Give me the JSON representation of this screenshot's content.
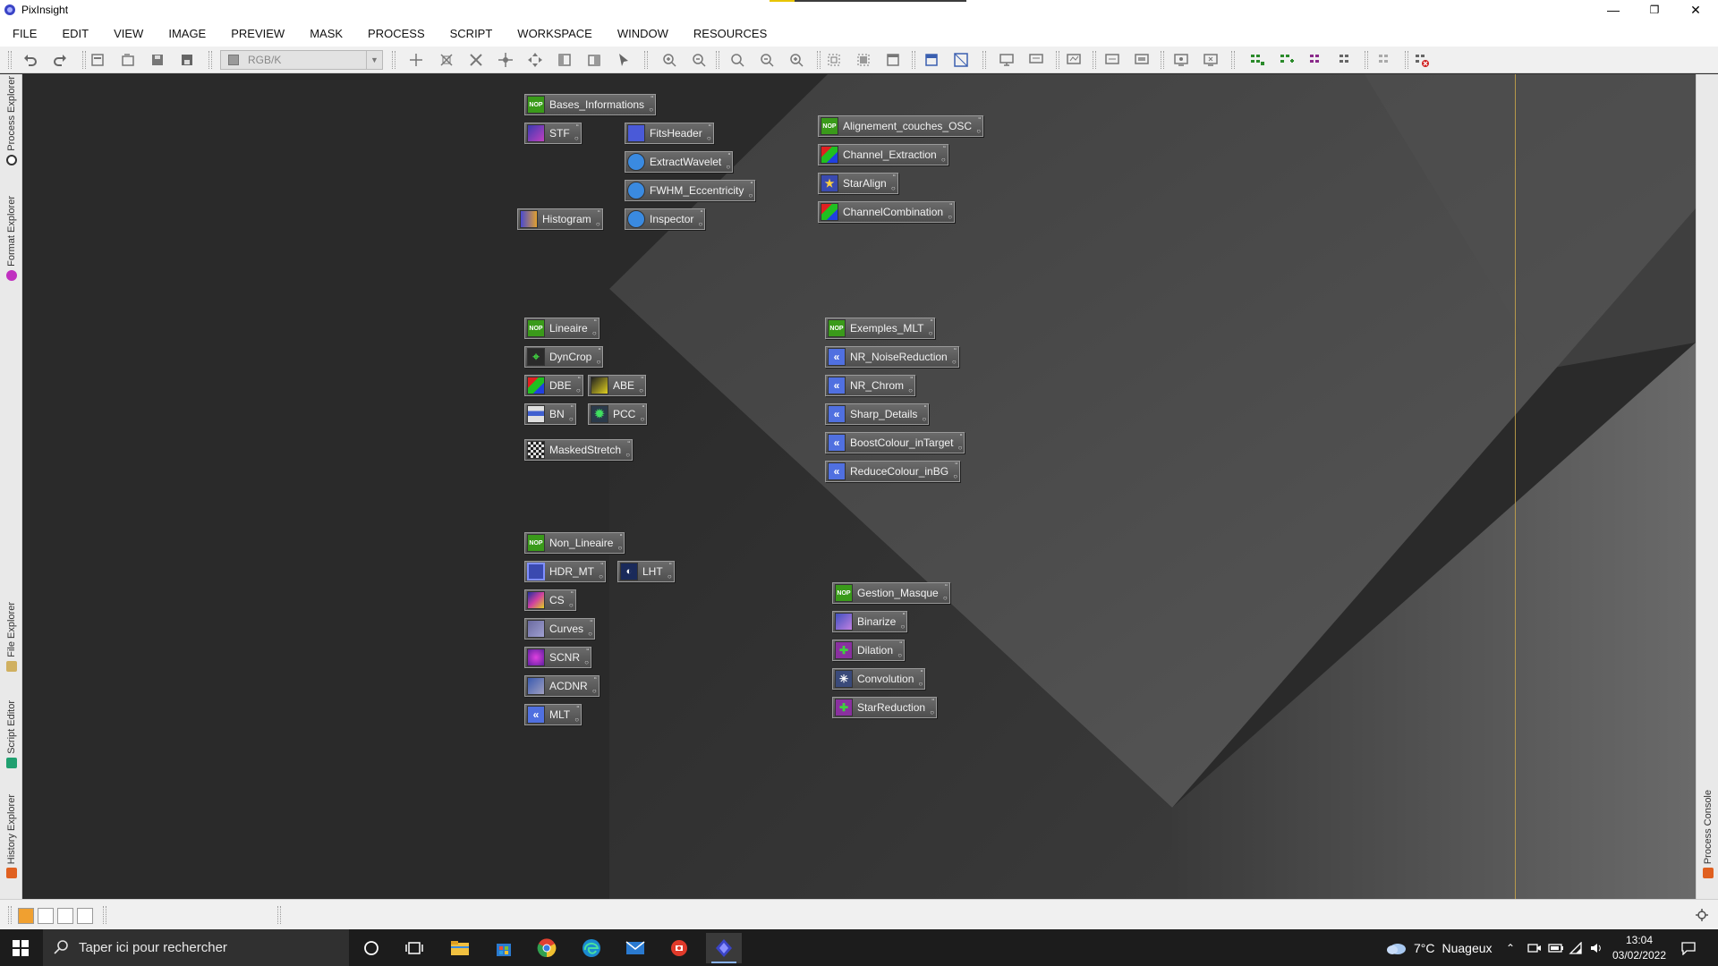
{
  "window": {
    "title": "PixInsight"
  },
  "menu": [
    "FILE",
    "EDIT",
    "VIEW",
    "IMAGE",
    "PREVIEW",
    "MASK",
    "PROCESS",
    "SCRIPT",
    "WORKSPACE",
    "WINDOW",
    "RESOURCES"
  ],
  "toolbar": {
    "colorspace": "RGB/K"
  },
  "left_tabs": {
    "process_explorer": "Process Explorer",
    "format_explorer": "Format Explorer",
    "file_explorer": "File Explorer",
    "script_editor": "Script Editor",
    "history_explorer": "History Explorer"
  },
  "right_tabs": {
    "process_console": "Process Console"
  },
  "process_icons": {
    "bases_informations": "Bases_Informations",
    "stf": "STF",
    "fitsheader": "FitsHeader",
    "extractwavelet": "ExtractWavelet",
    "fwhm_eccentricity": "FWHM_Eccentricity",
    "histogram": "Histogram",
    "inspector": "Inspector",
    "alignement_couches_osc": "Alignement_couches_OSC",
    "channel_extraction": "Channel_Extraction",
    "staralign": "StarAlign",
    "channelcombination": "ChannelCombination",
    "lineaire": "Lineaire",
    "dyncrop": "DynCrop",
    "dbe": "DBE",
    "abe": "ABE",
    "bn": "BN",
    "pcc": "PCC",
    "maskedstretch": "MaskedStretch",
    "exemples_mlt": "Exemples_MLT",
    "nr_noisereduction": "NR_NoiseReduction",
    "nr_chrom": "NR_Chrom",
    "sharp_details": "Sharp_Details",
    "boostcolour_intarget": "BoostColour_inTarget",
    "reducecolour_inbg": "ReduceColour_inBG",
    "non_lineaire": "Non_Lineaire",
    "hdr_mt": "HDR_MT",
    "lht": "LHT",
    "cs": "CS",
    "curves": "Curves",
    "scnr": "SCNR",
    "acdnr": "ACDNR",
    "mlt": "MLT",
    "gestion_masque": "Gestion_Masque",
    "binarize": "Binarize",
    "dilation": "Dilation",
    "convolution": "Convolution",
    "starreduction": "StarReduction"
  },
  "nop_badge": "NOP",
  "taskbar": {
    "search_placeholder": "Taper ici pour rechercher",
    "weather_temp": "7°C",
    "weather_desc": "Nuageux",
    "time": "13:04",
    "date": "03/02/2022"
  },
  "colors": {
    "nop_green": "#3a9a1a",
    "workspace_bg": "#2a2a2a",
    "accent_line": "#c9a64a"
  }
}
